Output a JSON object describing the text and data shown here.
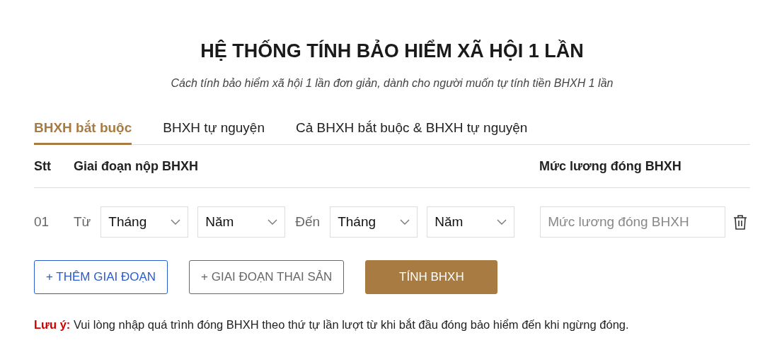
{
  "title": "HỆ THỐNG TÍNH BẢO HIỂM XÃ HỘI 1 LẦN",
  "subtitle": "Cách tính bảo hiểm xã hội 1 lần đơn giản, dành cho người muốn tự tính tiền BHXH 1 lần",
  "tabs": [
    {
      "label": "BHXH bắt buộc",
      "selected": true
    },
    {
      "label": "BHXH tự nguyện",
      "selected": false
    },
    {
      "label": "Cả BHXH bắt buộc & BHXH tự nguyện",
      "selected": false
    }
  ],
  "table": {
    "columns": [
      "Stt",
      "Giai đoạn nộp BHXH",
      "Mức lương đóng BHXH"
    ],
    "rows": [
      {
        "stt": "01",
        "from_label": "Từ",
        "from_month": "Tháng",
        "from_year": "Năm",
        "to_label": "Đến",
        "to_month": "Tháng",
        "to_year": "Năm",
        "salary_placeholder": "Mức lương đóng BHXH"
      }
    ]
  },
  "buttons": [
    {
      "label": "+ THÊM GIAI ĐOẠN",
      "kind": "outline-blue"
    },
    {
      "label": "+ GIAI ĐOẠN THAI SẢN",
      "kind": "outline-grey"
    },
    {
      "label": "TÍNH BHXH",
      "kind": "primary"
    }
  ],
  "note": {
    "label": "Lưu ý:",
    "text": "Vui lòng nhập quá trình đóng BHXH theo thứ tự lần lượt từ khi bắt đầu đóng bảo hiểm đến khi ngừng đóng."
  }
}
